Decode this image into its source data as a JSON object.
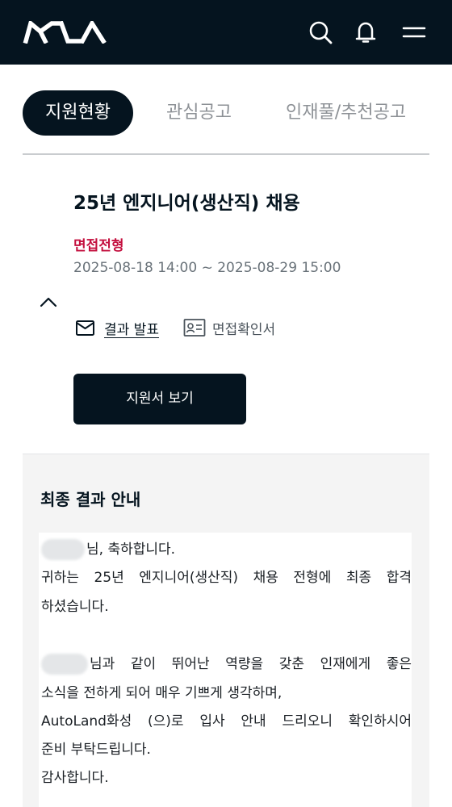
{
  "header": {
    "logo_text": "KIA",
    "icons": [
      "search-icon",
      "bell-icon",
      "menu-icon"
    ],
    "background": "#05141f"
  },
  "tabs": [
    {
      "label": "지원현황",
      "active": true
    },
    {
      "label": "관심공고",
      "active": false
    },
    {
      "label": "인재풀/추천공고",
      "active": false
    }
  ],
  "application": {
    "title": "25년 엔지니어(생산직) 채용",
    "stage": "면접전형",
    "period": "2025-08-18 14:00 ~ 2025-08-29 15:00",
    "result_link": "결과 발표",
    "confirm_link": "면접확인서",
    "view_button": "지원서 보기"
  },
  "result": {
    "heading": "최종 결과 안내",
    "line1": "님, 축하합니다.",
    "line2_words": [
      "귀하는",
      "25년",
      "엔지니어(생산직)",
      "채용",
      "전형에",
      "최종",
      "합격"
    ],
    "line3": "하셨습니다.",
    "line4_words": [
      "님과",
      "같이",
      "뛰어난",
      "역량을",
      "갖춘",
      "인재에게",
      "좋은"
    ],
    "line5": "소식을 전하게 되어 매우 기쁘게 생각하며,",
    "line6_words": [
      "AutoLand화성",
      "(으)로",
      "입사",
      "안내",
      "드리오니",
      "확인하시어"
    ],
    "line7": "준비 부탁드립니다.",
    "line8": "감사합니다."
  },
  "colors": {
    "brand_dark": "#05141f",
    "accent_red": "#c4103f",
    "muted_text": "#697279"
  }
}
